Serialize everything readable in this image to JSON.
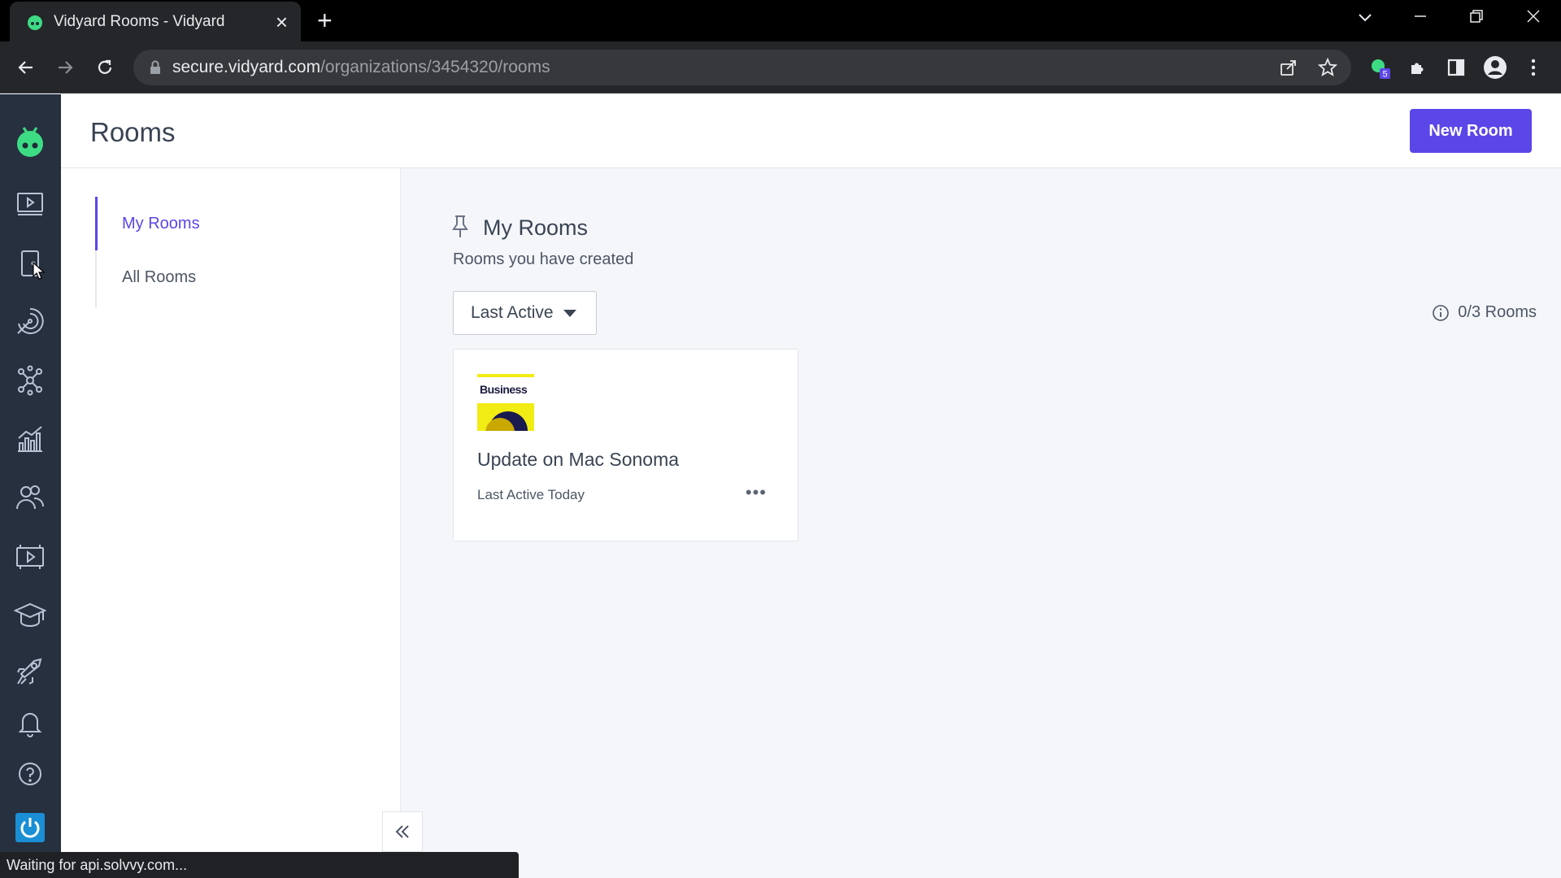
{
  "browser": {
    "tab_title": "Vidyard Rooms - Vidyard",
    "new_tab_icon": "plus-icon",
    "url_host": "secure.vidyard.com",
    "url_path": "/organizations/3454320/rooms",
    "extension_badge": "5",
    "status_text": "Waiting for api.solvvy.com..."
  },
  "header": {
    "title": "Rooms",
    "new_room_label": "New Room"
  },
  "subnav": {
    "items": [
      {
        "label": "My Rooms",
        "active": true
      },
      {
        "label": "All Rooms",
        "active": false
      }
    ]
  },
  "main": {
    "section_title": "My Rooms",
    "section_subtitle": "Rooms you have created",
    "sort_label": "Last Active",
    "quota": "0/3 Rooms",
    "rooms": [
      {
        "thumbnail_text": "Business",
        "title": "Update on Mac Sonoma",
        "meta": "Last Active Today",
        "more": "•••"
      }
    ]
  },
  "rail_icons": [
    "vidyard-logo-icon",
    "videos-icon",
    "rooms-icon",
    "prospecting-icon",
    "integrations-icon",
    "analytics-icon",
    "contacts-icon",
    "hubs-icon",
    "academy-icon",
    "launch-icon",
    "notifications-icon",
    "help-icon",
    "power-icon"
  ],
  "colors": {
    "accent": "#5b46e8",
    "rail": "#26303f",
    "page_bg": "#f4f6fa",
    "brand_green": "#3ddc84"
  }
}
